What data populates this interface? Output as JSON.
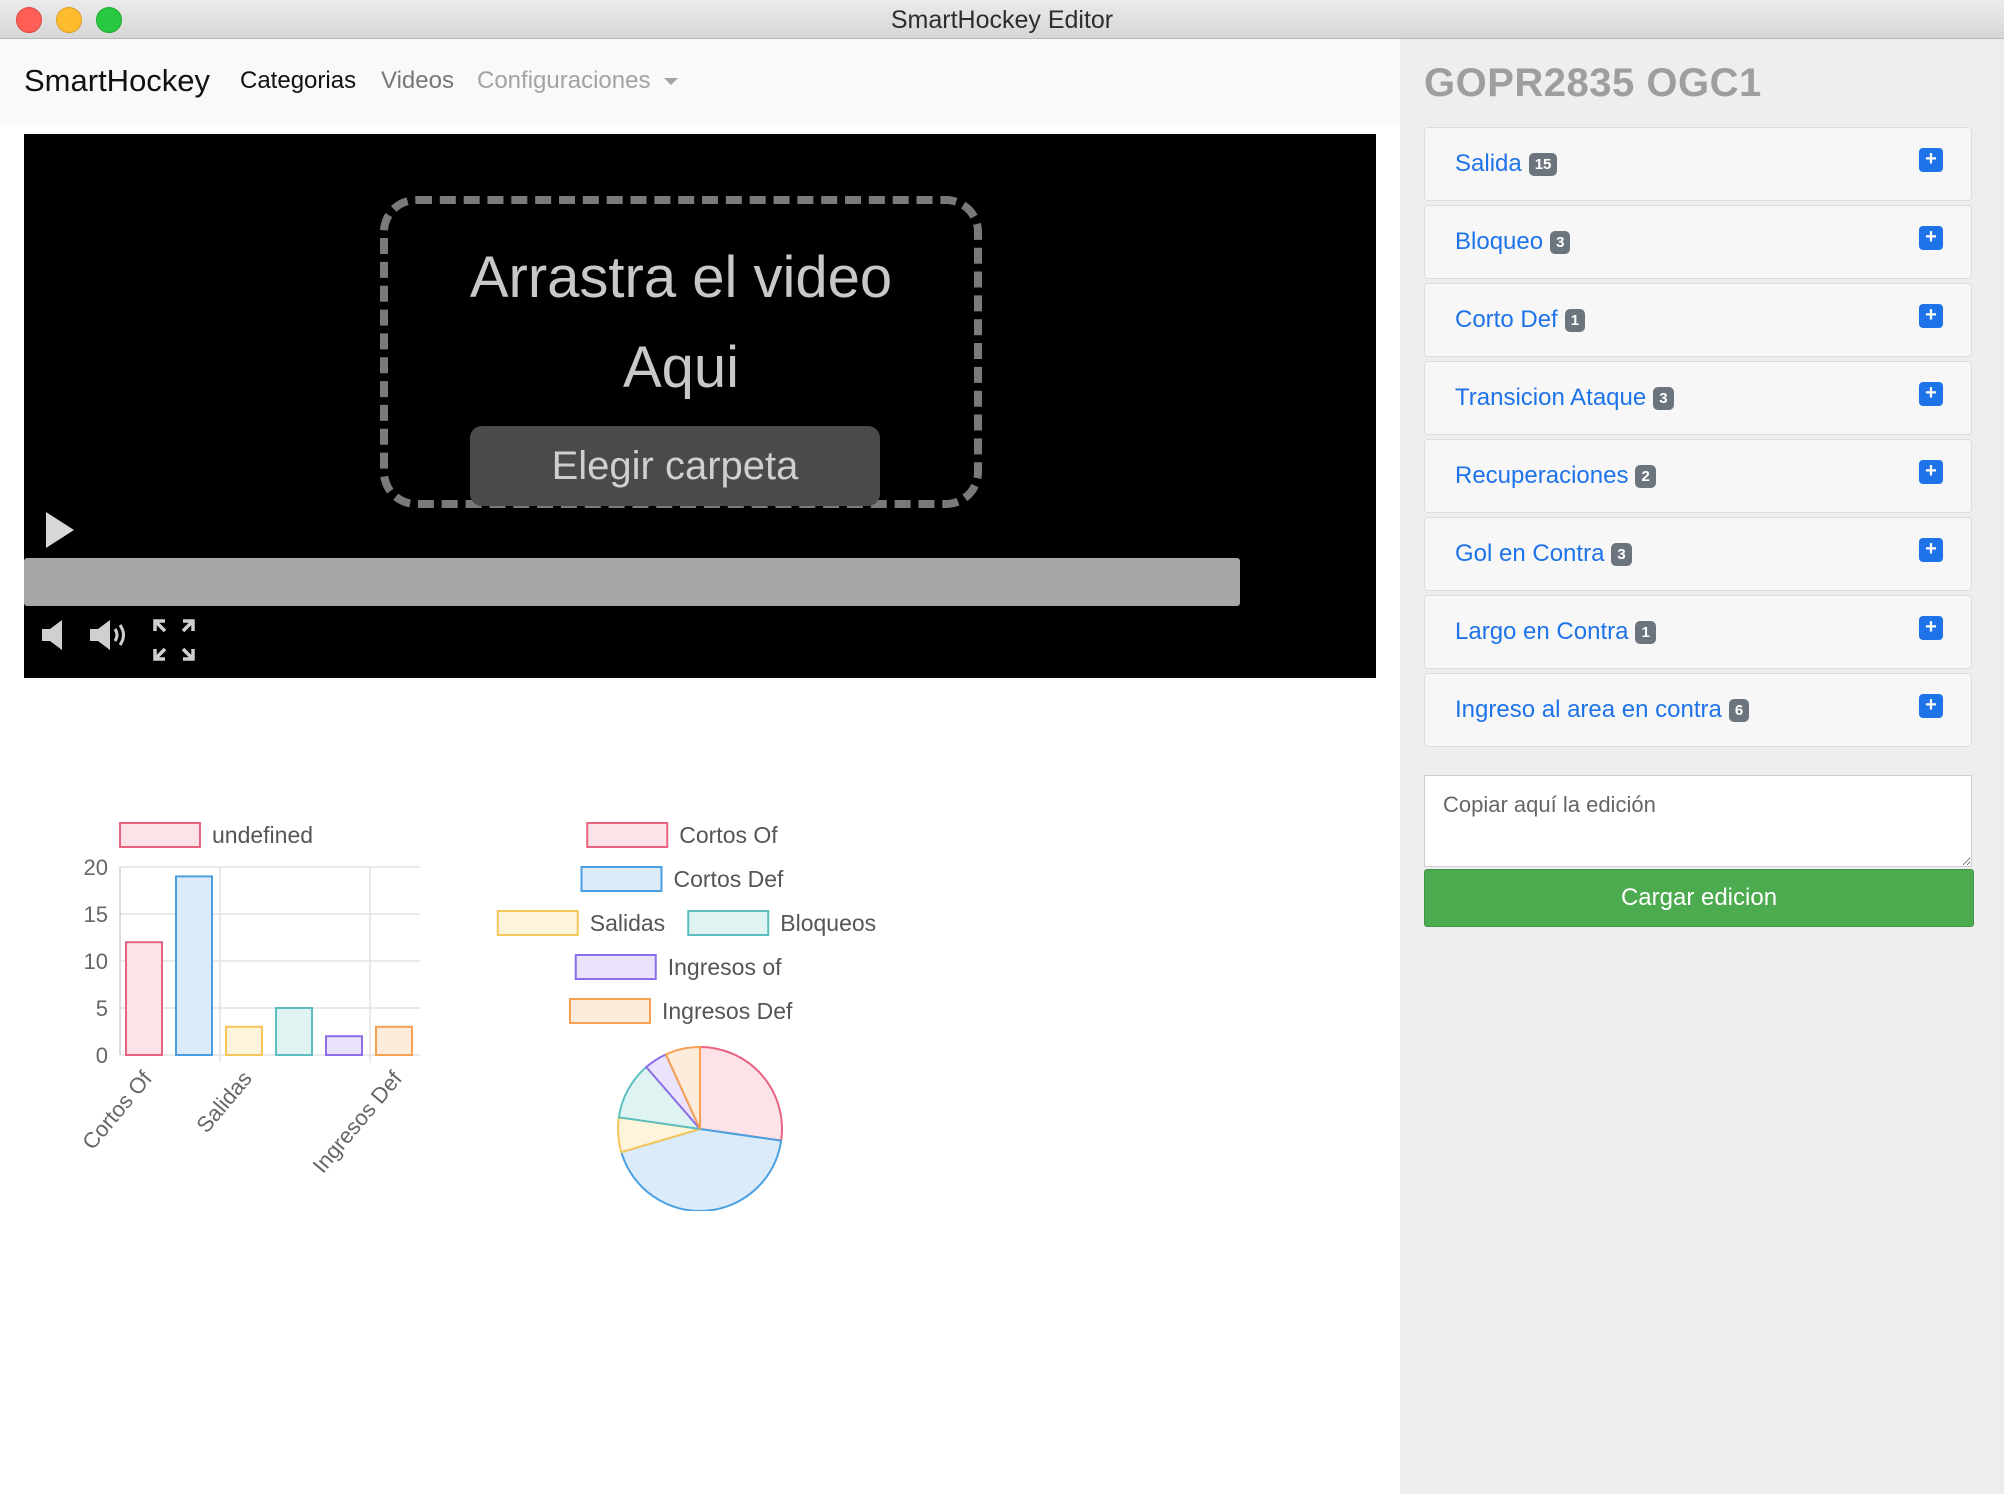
{
  "window": {
    "title": "SmartHockey Editor"
  },
  "navbar": {
    "brand": "SmartHockey",
    "links": [
      {
        "label": "Categorias",
        "state": "active"
      },
      {
        "label": "Videos",
        "state": "normal"
      },
      {
        "label": "Configuraciones",
        "state": "disabled",
        "dropdown": true
      }
    ]
  },
  "video": {
    "drop_line1": "Arrastra el video",
    "drop_line2": "Aqui",
    "choose_folder": "Elegir carpeta",
    "icons": [
      "play-icon",
      "volume-mute-icon",
      "volume-up-icon",
      "fullscreen-icon"
    ]
  },
  "sidebar": {
    "video_title": "GOPR2835 OGC1",
    "categories": [
      {
        "label": "Salida",
        "count": "15"
      },
      {
        "label": "Bloqueo",
        "count": "3"
      },
      {
        "label": "Corto Def",
        "count": "1"
      },
      {
        "label": "Transicion Ataque",
        "count": "3"
      },
      {
        "label": "Recuperaciones",
        "count": "2"
      },
      {
        "label": "Gol en Contra",
        "count": "3"
      },
      {
        "label": "Largo en Contra",
        "count": "1"
      },
      {
        "label": "Ingreso al area en contra",
        "count": "6"
      }
    ],
    "edition_placeholder": "Copiar aquí la edición",
    "load_button": "Cargar edicion"
  },
  "colors": {
    "link": "#1f73e8",
    "badge": "#6c757d",
    "load_button": "#4caa4f",
    "series": [
      "#e8637f",
      "#4a9fe0",
      "#f5c65a",
      "#5cbfbf",
      "#8e6ee8",
      "#f5a052"
    ],
    "fills": [
      "#fde3e8",
      "#dcebfa",
      "#fdf4dc",
      "#dff3f3",
      "#ebe3fc",
      "#fdebdc"
    ]
  },
  "chart_data": [
    {
      "type": "bar",
      "legend": [
        "undefined"
      ],
      "categories": [
        "Cortos Of",
        "Cortos Def",
        "Salidas",
        "Bloqueos",
        "Ingresos of",
        "Ingresos Def"
      ],
      "shown_tick_labels": [
        "Cortos Of",
        "Salidas",
        "Ingresos Def"
      ],
      "values": [
        12,
        19,
        3,
        5,
        2,
        3
      ],
      "yticks": [
        0,
        5,
        10,
        15,
        20
      ],
      "ylim": [
        0,
        20
      ],
      "grid": true,
      "legend_position": "top"
    },
    {
      "type": "pie",
      "legend": [
        "Cortos Of",
        "Cortos Def",
        "Salidas",
        "Bloqueos",
        "Ingresos of",
        "Ingresos Def"
      ],
      "values": [
        12,
        19,
        3,
        5,
        2,
        3
      ],
      "legend_position": "top"
    }
  ]
}
